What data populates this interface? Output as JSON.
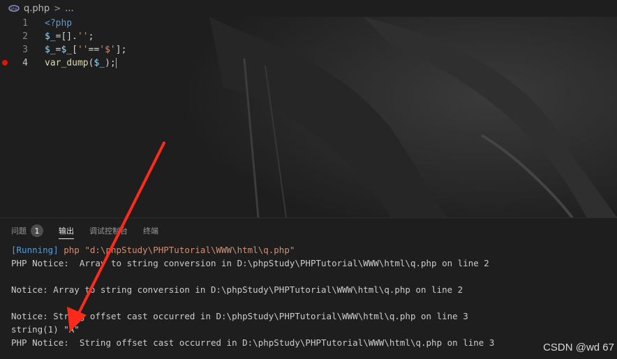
{
  "breadcrumb": {
    "file": "q.php",
    "more": "..."
  },
  "editor": {
    "active_line": "4",
    "lines": [
      {
        "number": "1"
      },
      {
        "number": "2"
      },
      {
        "number": "3"
      },
      {
        "number": "4",
        "breakpoint": true
      }
    ],
    "code": {
      "l1": {
        "open_tag": "<?php"
      },
      "l2": {
        "var": "$_",
        "op": "=[].",
        "str": "''",
        "end": ";"
      },
      "l3": {
        "var": "$_",
        "op1": "=",
        "var2": "$_",
        "op2": "[",
        "str1": "''",
        "op3": "==",
        "str2": "'$'",
        "end": "];"
      },
      "l4": {
        "fn": "var_dump",
        "op1": "(",
        "var": "$_",
        "end": ");"
      }
    }
  },
  "panel": {
    "tabs": [
      {
        "label": "问题",
        "badge": "1"
      },
      {
        "label": "输出",
        "active": true
      },
      {
        "label": "调试控制台"
      },
      {
        "label": "终端"
      }
    ],
    "output": {
      "running_tag": "[Running]",
      "command": " php \"d:\\phpStudy\\PHPTutorial\\WWW\\html\\q.php\"",
      "lines": [
        "PHP Notice:  Array to string conversion in D:\\phpStudy\\PHPTutorial\\WWW\\html\\q.php on line 2",
        "",
        "Notice: Array to string conversion in D:\\phpStudy\\PHPTutorial\\WWW\\html\\q.php on line 2",
        "",
        "Notice: String offset cast occurred in D:\\phpStudy\\PHPTutorial\\WWW\\html\\q.php on line 3",
        "string(1) \"A\"",
        "PHP Notice:  String offset cast occurred in D:\\phpStudy\\PHPTutorial\\WWW\\html\\q.php on line 3"
      ]
    }
  },
  "watermark": "CSDN @wd 67",
  "annotation_color": "#ff2a1a"
}
